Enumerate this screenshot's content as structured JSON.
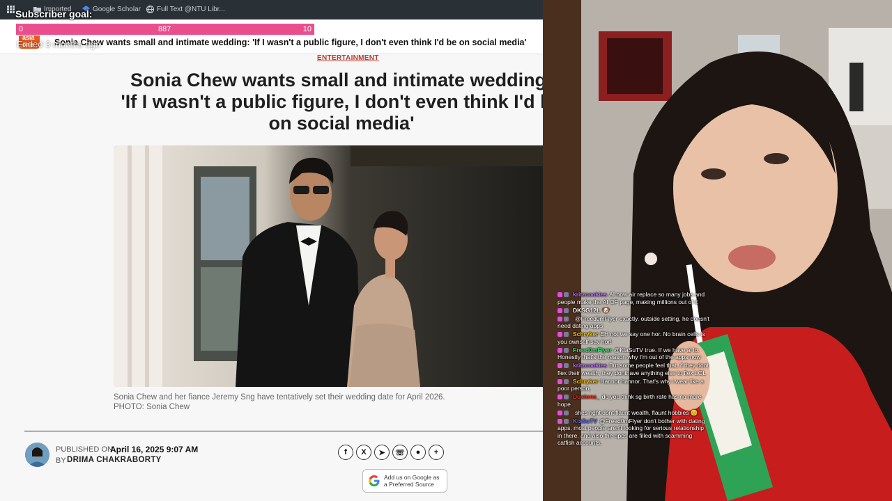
{
  "bookmarks": [
    {
      "label": "Imported",
      "icon": "folder-icon"
    },
    {
      "label": "Google Scholar",
      "icon": "scholar-icon"
    },
    {
      "label": "Full Text @NTU Libr...",
      "icon": "globe-icon"
    }
  ],
  "overlay": {
    "subscriber_goal_title": "Subscriber goal:",
    "bar_start": "0",
    "bar_current": "887",
    "bar_end": "10",
    "ended_text": "Ended 3 months ago"
  },
  "article": {
    "site_logo_text": "asia one",
    "header_title": "Sonia Chew wants small and intimate wedding: 'If I wasn't a public figure, I don't even think I'd be on social media'",
    "section": "ENTERTAINMENT",
    "headline": "Sonia Chew wants small and intimate wedding:\n'If I wasn't a public figure, I don't even think I'd be\non social media'",
    "caption": "Sonia Chew and her fiance Jeremy Sng have tentatively set their wedding date for April 2026.\nPHOTO: Sonia Chew",
    "published_label": "PUBLISHED ON",
    "published_date": "April 16, 2025 9:07 AM",
    "by_label": "BY",
    "author": "DRIMA CHAKRABORTY",
    "share_buttons": [
      {
        "name": "facebook-icon",
        "glyph": "f"
      },
      {
        "name": "x-icon",
        "glyph": "X"
      },
      {
        "name": "telegram-icon",
        "glyph": "➤"
      },
      {
        "name": "whatsapp-icon",
        "glyph": "☏"
      },
      {
        "name": "reddit-icon",
        "glyph": "●"
      },
      {
        "name": "plus-icon",
        "glyph": "+"
      }
    ],
    "google_badge_text": "Add us on Google as\na Preferred Source"
  },
  "chat": [
    {
      "user": "kritzcookies",
      "color": "#b26bff",
      "text": "AI now air replace so many jobs and people make the AI OF page, making millions out of it"
    },
    {
      "user": "DKSG12L",
      "color": "#ffffff",
      "text": "🐶"
    },
    {
      "user": "",
      "color": "#5b6cff",
      "text": "@Freed0mFlyer exactly. outside setting, he doesn't need dating apps"
    },
    {
      "user": "Schryker",
      "color": "#f2c200",
      "text": "EH not we say one hor. No brain cells is you ownself say hor!"
    },
    {
      "user": "Freed0mFlyer",
      "color": "#3be06a",
      "text": "@KiaSuTV true. If we have ai lo. Honestly that's the reason why I'm out of the apps now"
    },
    {
      "user": "kritzcookies",
      "color": "#b26bff",
      "text": "But some people feel that, if they dont flex their wealth, they donthave anything else to flex LOL"
    },
    {
      "user": "Schryker",
      "color": "#f2c200",
      "text": "Hannor hannor. That's why i wear like a poor person."
    },
    {
      "user": "Duxtons_",
      "color": "#d23b2a",
      "text": "do you think sg birth rate has no more hope"
    },
    {
      "user": "",
      "color": "#5b6cff",
      "text": "shes right dont flaunt wealth, flaunt hobbies 😊"
    },
    {
      "user": "KiaSuTV",
      "color": "#5b6cff",
      "text": "@Freed0mFlyer don't bother with dating apps. most people aren't looking for serious relationship in there. and also the apps are filled with scamming catfish accounts."
    }
  ]
}
